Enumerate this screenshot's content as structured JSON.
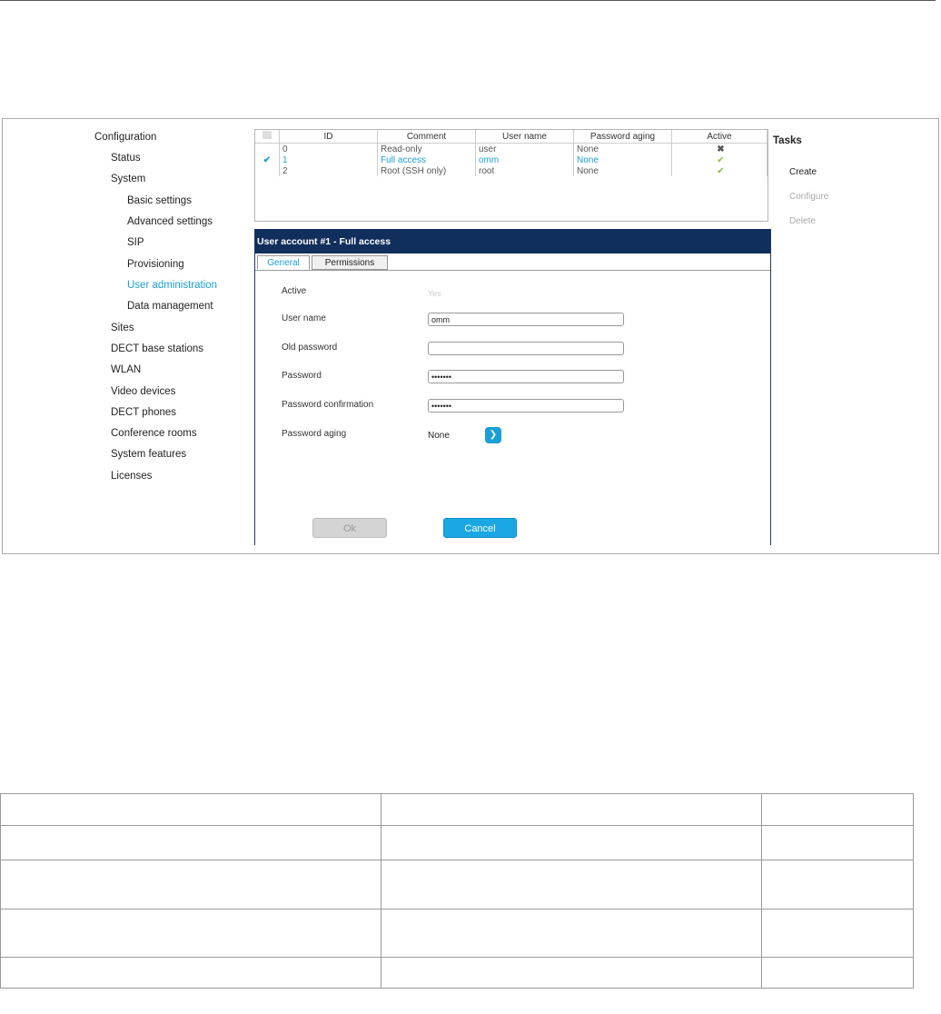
{
  "sidebar": {
    "items": [
      {
        "label": "Configuration",
        "level": 0,
        "active": false
      },
      {
        "label": "Status",
        "level": 1,
        "active": false
      },
      {
        "label": "System",
        "level": 1,
        "active": false
      },
      {
        "label": "Basic settings",
        "level": 2,
        "active": false
      },
      {
        "label": "Advanced settings",
        "level": 2,
        "active": false
      },
      {
        "label": "SIP",
        "level": 2,
        "active": false
      },
      {
        "label": "Provisioning",
        "level": 2,
        "active": false
      },
      {
        "label": "User administration",
        "level": 2,
        "active": true
      },
      {
        "label": "Data management",
        "level": 2,
        "active": false
      },
      {
        "label": "Sites",
        "level": 1,
        "active": false
      },
      {
        "label": "DECT base stations",
        "level": 1,
        "active": false
      },
      {
        "label": "WLAN",
        "level": 1,
        "active": false
      },
      {
        "label": "Video devices",
        "level": 1,
        "active": false
      },
      {
        "label": "DECT phones",
        "level": 1,
        "active": false
      },
      {
        "label": "Conference rooms",
        "level": 1,
        "active": false
      },
      {
        "label": "System features",
        "level": 1,
        "active": false
      },
      {
        "label": "Licenses",
        "level": 1,
        "active": false
      }
    ]
  },
  "users_table": {
    "columns": [
      "ID",
      "Comment",
      "User name",
      "Password aging",
      "Active"
    ],
    "rows": [
      {
        "selected": false,
        "id": "0",
        "comment": "Read-only",
        "user": "user",
        "aging": "None",
        "active": "✖"
      },
      {
        "selected": true,
        "id": "1",
        "comment": "Full access",
        "user": "omm",
        "aging": "None",
        "active": "✔"
      },
      {
        "selected": false,
        "id": "2",
        "comment": "Root (SSH only)",
        "user": "root",
        "aging": "None",
        "active": "✔"
      }
    ],
    "selected_mark": "✔"
  },
  "tasks": {
    "title": "Tasks",
    "create": "Create",
    "configure": "Configure",
    "delete": "Delete"
  },
  "dialog": {
    "title": "User account #1 - Full access",
    "tab_general": "General",
    "tab_permissions": "Permissions",
    "active_label": "Active",
    "active_value": "Yes",
    "username_label": "User name",
    "username_value": "omm",
    "old_password_label": "Old password",
    "old_password_value": "",
    "password_label": "Password",
    "password_value": "•••••••",
    "confirm_label": "Password confirmation",
    "confirm_value": "•••••••",
    "aging_label": "Password aging",
    "aging_value": "None",
    "ok_label": "Ok",
    "cancel_label": "Cancel"
  },
  "colors": {
    "accent": "#1a9fd8",
    "dialog_header": "#112f5c"
  }
}
